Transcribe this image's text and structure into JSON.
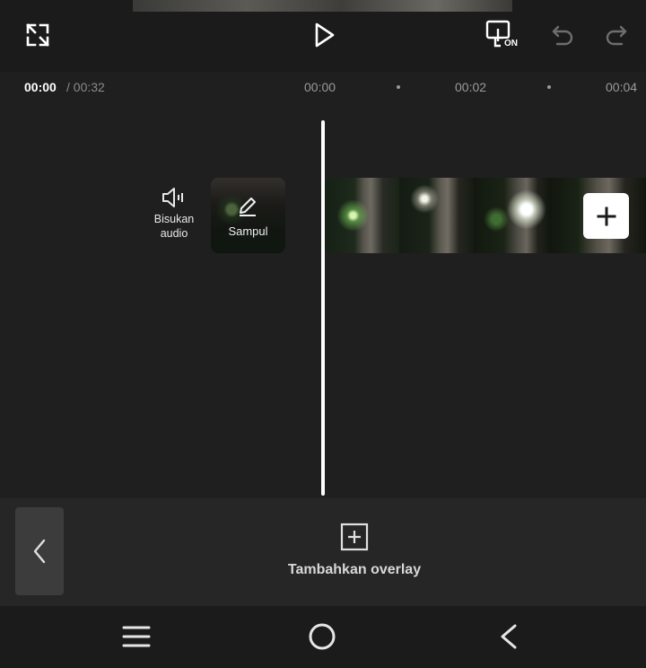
{
  "toolbar": {
    "fullscreen_icon": "expand-icon",
    "play_icon": "play-icon",
    "preview_toggle_icon": "preview-on-icon",
    "preview_toggle_badge": "ON",
    "undo_icon": "undo-icon",
    "redo_icon": "redo-icon"
  },
  "timecode": {
    "current": "00:00",
    "total": "/ 00:32"
  },
  "ruler": {
    "ticks": [
      "00:00",
      "00:02",
      "00:04"
    ]
  },
  "track": {
    "mute_audio_label_line1": "Bisukan",
    "mute_audio_label_line2": "audio",
    "cover_label": "Sampul"
  },
  "bottom_panel": {
    "add_overlay_label": "Tambahkan overlay"
  },
  "colors": {
    "background": "#1b1b1b",
    "panel": "#262626",
    "playhead": "#ffffff"
  }
}
